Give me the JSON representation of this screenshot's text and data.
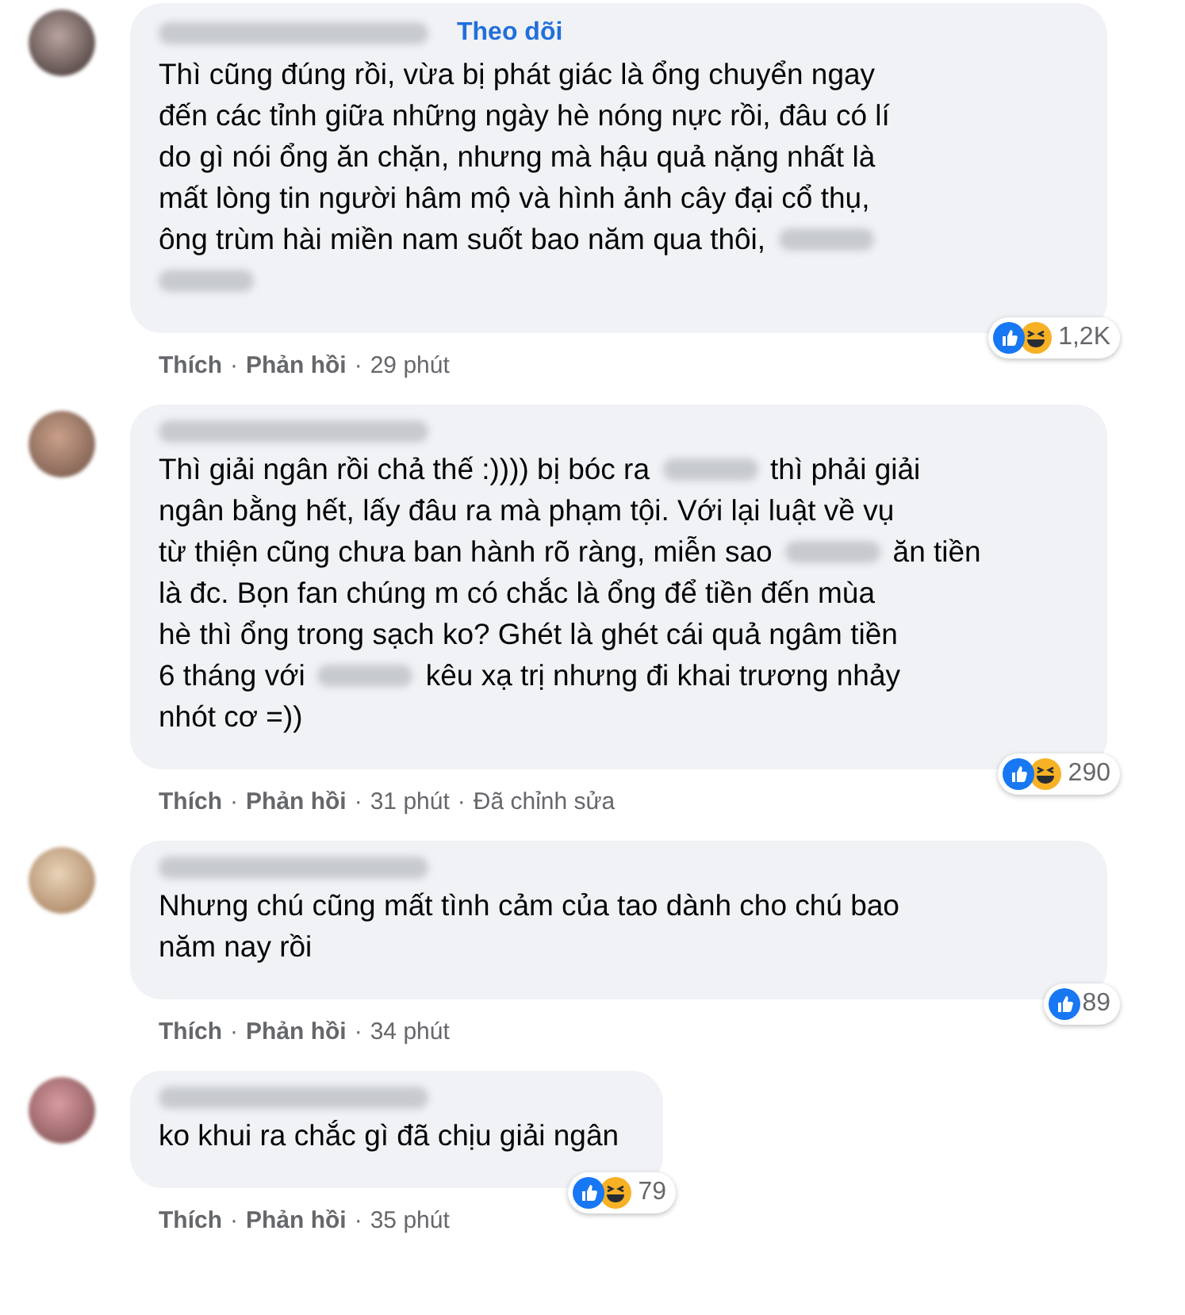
{
  "comments": [
    {
      "follow_link": "Theo dõi",
      "lines": [
        [
          {
            "kind": "text",
            "text": "Thì cũng đúng rồi, vừa bị phát giác là ổng chuyển ngay"
          }
        ],
        [
          {
            "kind": "text",
            "text": "đến các tỉnh giữa những ngày hè nóng nực rồi, đâu có lí"
          }
        ],
        [
          {
            "kind": "text",
            "text": "do gì nói ổng ăn chặn, nhưng mà hậu quả nặng nhất là"
          }
        ],
        [
          {
            "kind": "text",
            "text": "mất lòng tin người hâm mộ và hình ảnh cây đại cổ thụ,"
          }
        ],
        [
          {
            "kind": "text",
            "text": "ông trùm hài miền nam suốt bao năm qua thôi,"
          },
          {
            "kind": "redacted"
          }
        ],
        [
          {
            "kind": "redacted"
          }
        ]
      ],
      "reactions": [
        {
          "kind": "like"
        },
        {
          "kind": "haha"
        }
      ],
      "reaction_count": "1,2K",
      "meta": [
        {
          "kind": "action",
          "text": "Thích"
        },
        {
          "kind": "separator",
          "text": "·"
        },
        {
          "kind": "action",
          "text": "Phản hồi"
        },
        {
          "kind": "separator",
          "text": "·"
        },
        {
          "kind": "time",
          "text": "29 phút"
        }
      ]
    },
    {
      "lines": [
        [
          {
            "kind": "text",
            "text": "Thì giải ngân rồi chả thế :)))) bị bóc ra"
          },
          {
            "kind": "redacted"
          },
          {
            "kind": "text",
            "text": "thì phải giải"
          }
        ],
        [
          {
            "kind": "text",
            "text": "ngân bằng hết, lấy đâu ra mà phạm tội. Với lại luật về vụ"
          }
        ],
        [
          {
            "kind": "text",
            "text": "từ thiện cũng chưa ban hành rõ ràng, miễn sao"
          },
          {
            "kind": "redacted"
          },
          {
            "kind": "text",
            "text": "ăn tiền"
          }
        ],
        [
          {
            "kind": "text",
            "text": "là đc. Bọn fan chúng m có chắc là ổng để tiền đến mùa"
          }
        ],
        [
          {
            "kind": "text",
            "text": "hè thì ổng trong sạch ko? Ghét là ghét cái quả ngâm tiền"
          }
        ],
        [
          {
            "kind": "text",
            "text": "6 tháng với"
          },
          {
            "kind": "redacted"
          },
          {
            "kind": "text",
            "text": "kêu xạ trị nhưng đi khai trương nhảy"
          }
        ],
        [
          {
            "kind": "text",
            "text": "nhót cơ =))"
          }
        ]
      ],
      "reactions": [
        {
          "kind": "like"
        },
        {
          "kind": "haha"
        }
      ],
      "reaction_count": "290",
      "meta": [
        {
          "kind": "action",
          "text": "Thích"
        },
        {
          "kind": "separator",
          "text": "·"
        },
        {
          "kind": "action",
          "text": "Phản hồi"
        },
        {
          "kind": "separator",
          "text": "·"
        },
        {
          "kind": "time",
          "text": "31 phút"
        },
        {
          "kind": "separator",
          "text": "·"
        },
        {
          "kind": "time",
          "text": "Đã chỉnh sửa"
        }
      ]
    },
    {
      "lines": [
        [
          {
            "kind": "text",
            "text": "Nhưng chú cũng mất tình cảm của tao dành cho chú bao"
          }
        ],
        [
          {
            "kind": "text",
            "text": "năm nay rồi"
          }
        ]
      ],
      "reactions": [
        {
          "kind": "like"
        }
      ],
      "reaction_count": "89",
      "meta": [
        {
          "kind": "action",
          "text": "Thích"
        },
        {
          "kind": "separator",
          "text": "·"
        },
        {
          "kind": "action",
          "text": "Phản hồi"
        },
        {
          "kind": "separator",
          "text": "·"
        },
        {
          "kind": "time",
          "text": "34 phút"
        }
      ]
    },
    {
      "lines": [
        [
          {
            "kind": "text",
            "text": "ko khui ra chắc gì đã chịu giải ngân"
          }
        ]
      ],
      "reactions": [
        {
          "kind": "like"
        },
        {
          "kind": "haha"
        }
      ],
      "reaction_count": "79",
      "meta": [
        {
          "kind": "action",
          "text": "Thích"
        },
        {
          "kind": "separator",
          "text": "·"
        },
        {
          "kind": "action",
          "text": "Phản hồi"
        },
        {
          "kind": "separator",
          "text": "·"
        },
        {
          "kind": "time",
          "text": "35 phút"
        }
      ]
    }
  ]
}
